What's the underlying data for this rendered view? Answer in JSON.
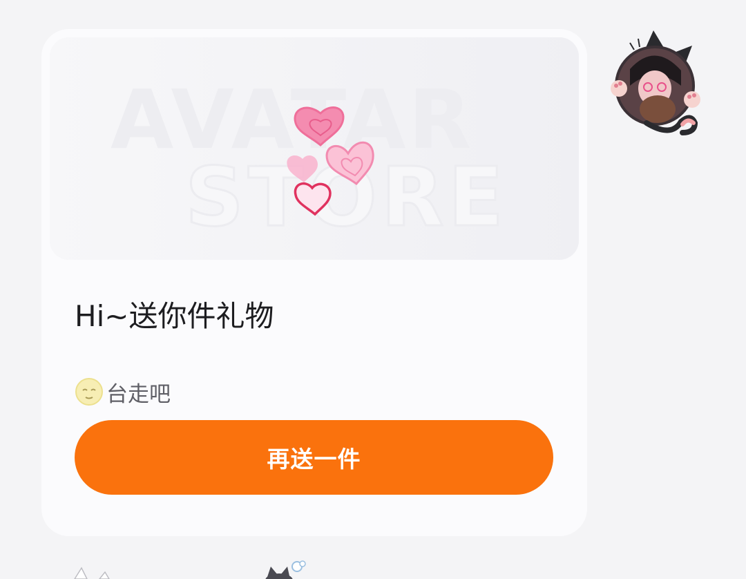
{
  "card": {
    "banner": {
      "line1": "AVATAR",
      "line2": "STORE"
    },
    "title": "Hi~送你件礼物",
    "message": "台走吧",
    "emoji_icon": "moon-face-emoji-icon",
    "button_label": "再送一件"
  },
  "colors": {
    "accent": "#fa720d",
    "card_bg": "#fbfbfd",
    "page_bg": "#f4f4f6",
    "heart_pink": "#f07aa4",
    "heart_red": "#e0325f"
  },
  "sender": {
    "avatar_icon": "cat-ear-girl-avatar"
  }
}
